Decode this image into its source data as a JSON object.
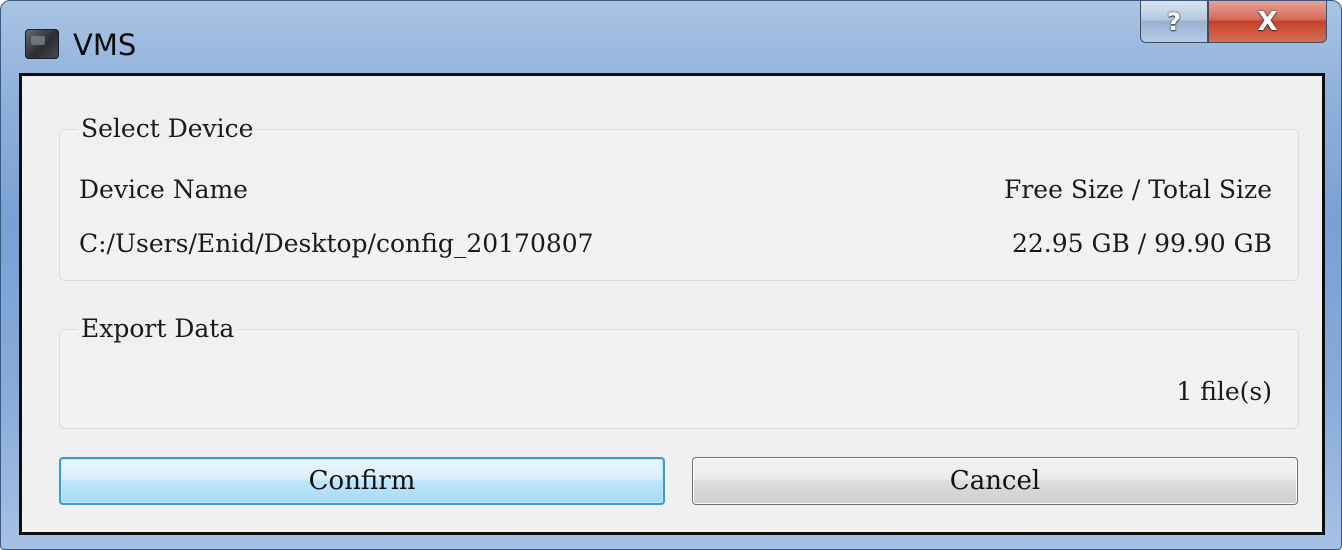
{
  "window": {
    "title": "VMS",
    "help_glyph": "?",
    "close_glyph": "X",
    "icons": {
      "app": "vms-app-icon",
      "help": "help-icon",
      "close": "close-icon"
    }
  },
  "select_device": {
    "legend": "Select Device",
    "col_name_header": "Device Name",
    "col_size_header": "Free Size / Total Size",
    "device_name": "C:/Users/Enid/Desktop/config_20170807",
    "device_size": "22.95 GB / 99.90 GB"
  },
  "export_data": {
    "legend": "Export Data",
    "file_count": "1 file(s)"
  },
  "buttons": {
    "confirm": "Confirm",
    "cancel": "Cancel"
  },
  "colors": {
    "title_bar": "#7aa0d4",
    "close_button": "#c5402b",
    "focus_border": "#3c9ad8"
  }
}
